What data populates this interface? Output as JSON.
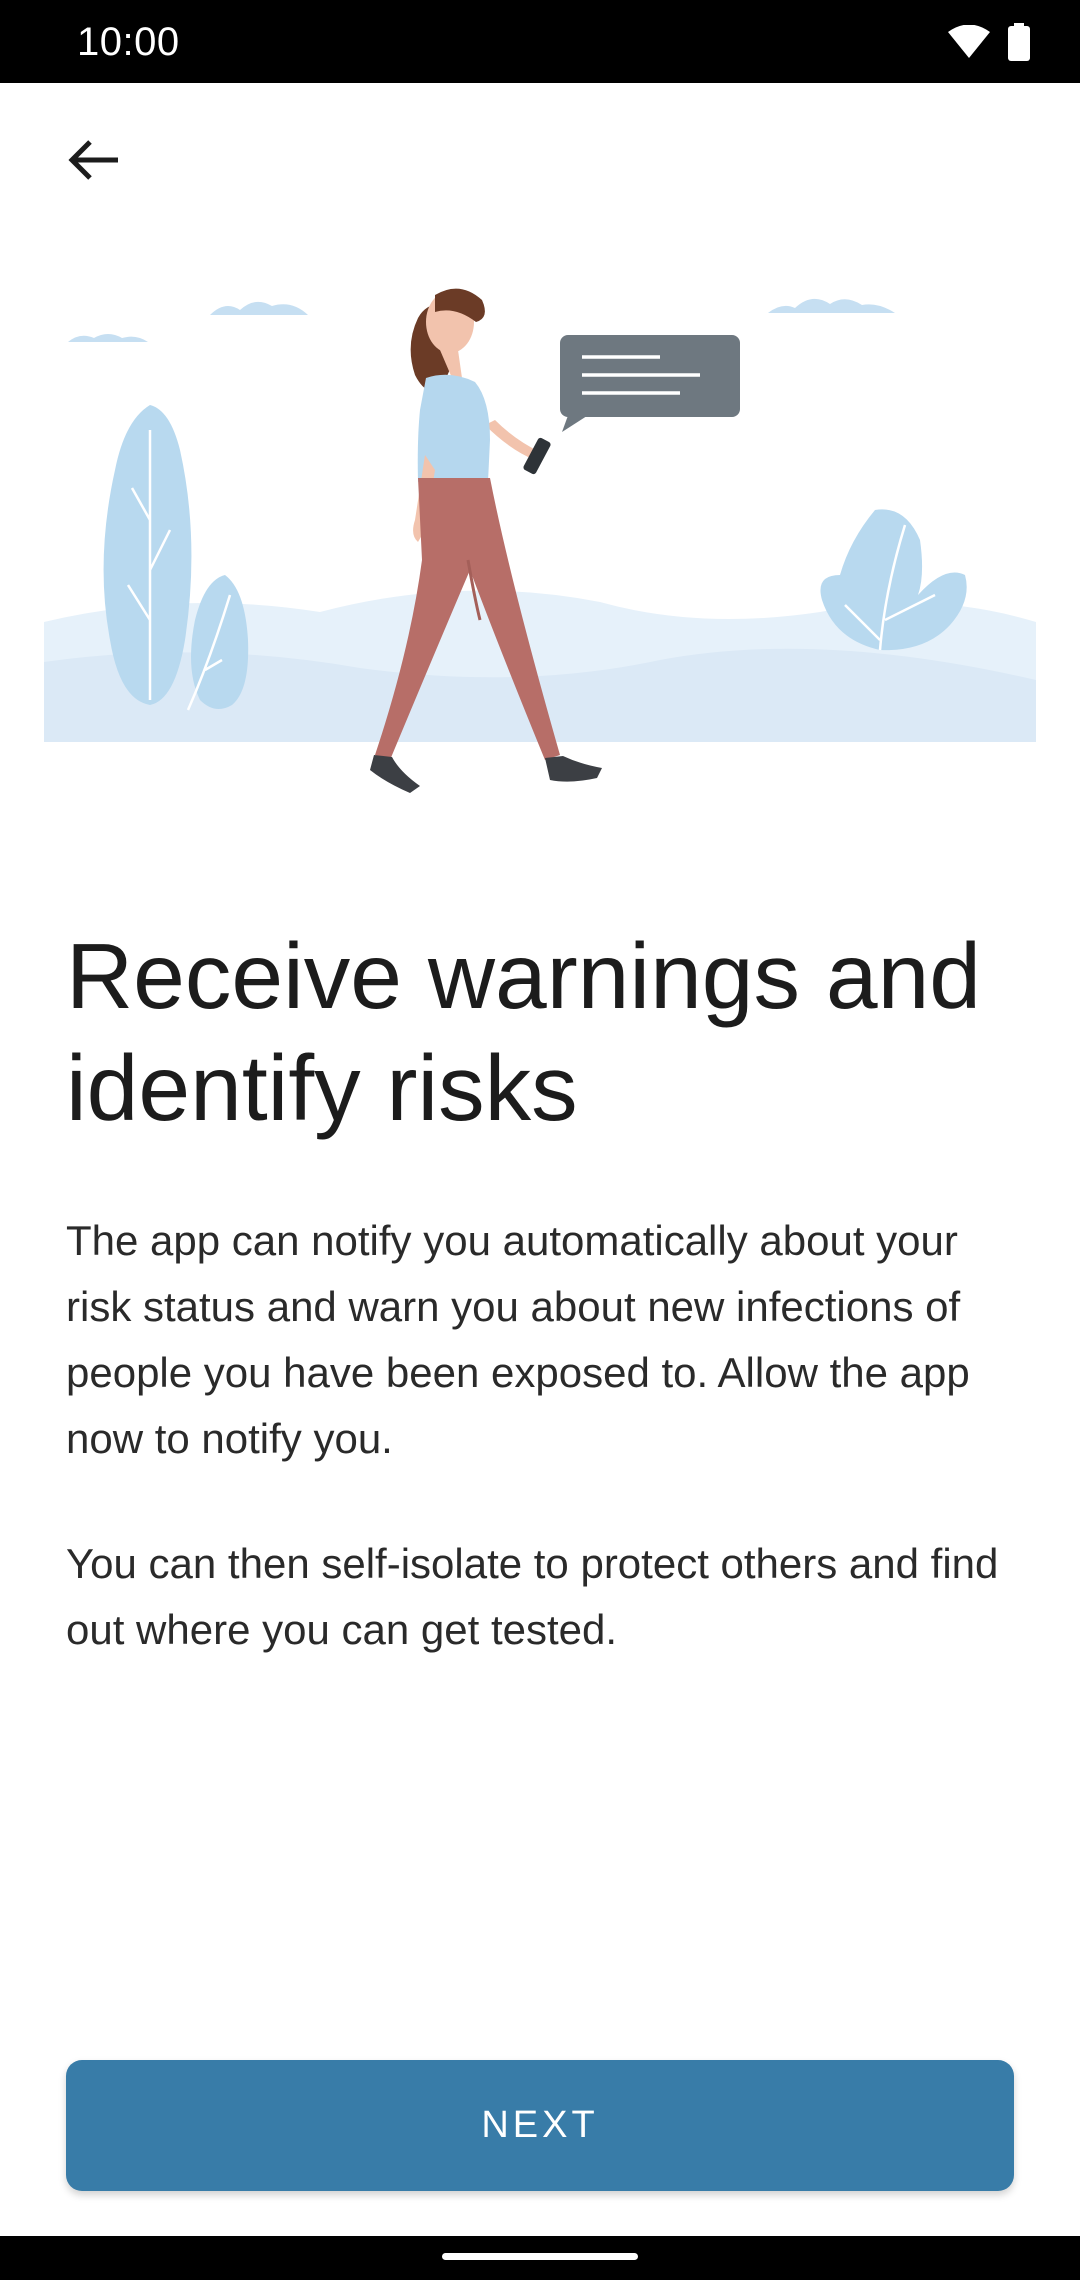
{
  "status_bar": {
    "time": "10:00",
    "icons": [
      "wifi-icon",
      "battery-icon"
    ]
  },
  "header": {
    "back_icon": "arrow-back-icon"
  },
  "illustration": {
    "subject": "woman-walking-with-phone-illustration"
  },
  "content": {
    "title": "Receive warnings and identify risks",
    "paragraph_1": "The app can notify you automatically about your risk status and warn you about new infections of people you have been exposed to. Allow the app now to notify you.",
    "paragraph_2": "You can then self-isolate to protect others and find out where you can get tested."
  },
  "actions": {
    "next_label": "NEXT"
  },
  "colors": {
    "accent": "#387ca8",
    "illustration_light_blue": "#b8d9ef",
    "speech_bubble": "#6e7880"
  }
}
